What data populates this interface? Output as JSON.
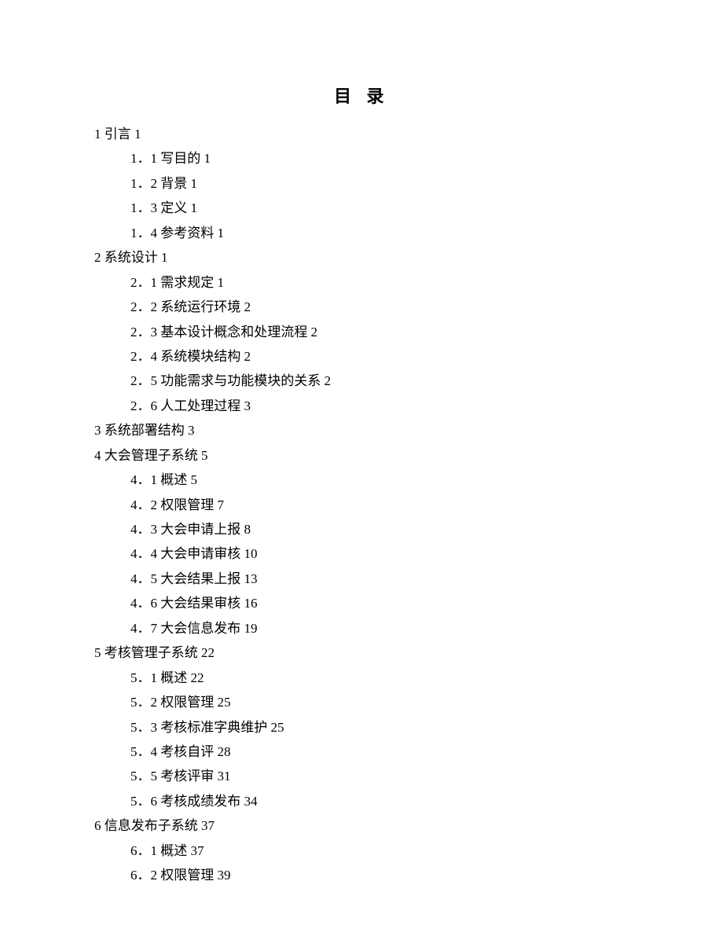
{
  "title": "目 录",
  "toc": [
    {
      "level": 1,
      "num": "1",
      "title": "引言",
      "page": "1"
    },
    {
      "level": 2,
      "num": "1．1",
      "title": "写目的",
      "page": "1"
    },
    {
      "level": 2,
      "num": "1．2",
      "title": "背景",
      "page": "1"
    },
    {
      "level": 2,
      "num": "1．3",
      "title": "定义",
      "page": "1"
    },
    {
      "level": 2,
      "num": "1．4",
      "title": "参考资料",
      "page": "1"
    },
    {
      "level": 1,
      "num": "2",
      "title": "系统设计",
      "page": "1"
    },
    {
      "level": 2,
      "num": "2．1",
      "title": "需求规定",
      "page": "1"
    },
    {
      "level": 2,
      "num": "2．2",
      "title": "系统运行环境",
      "page": "2"
    },
    {
      "level": 2,
      "num": "2．3",
      "title": "基本设计概念和处理流程",
      "page": "2"
    },
    {
      "level": 2,
      "num": "2．4",
      "title": "系统模块结构",
      "page": "2"
    },
    {
      "level": 2,
      "num": "2．5",
      "title": "功能需求与功能模块的关系",
      "page": "2"
    },
    {
      "level": 2,
      "num": "2．6",
      "title": "人工处理过程",
      "page": "3"
    },
    {
      "level": 1,
      "num": "3",
      "title": "系统部署结构",
      "page": "3"
    },
    {
      "level": 1,
      "num": "4",
      "title": "大会管理子系统",
      "page": "5"
    },
    {
      "level": 2,
      "num": "4．1",
      "title": "概述",
      "page": "5"
    },
    {
      "level": 2,
      "num": "4．2",
      "title": "权限管理",
      "page": "7"
    },
    {
      "level": 2,
      "num": "4．3",
      "title": "大会申请上报",
      "page": "8"
    },
    {
      "level": 2,
      "num": "4．4",
      "title": "大会申请审核",
      "page": "10"
    },
    {
      "level": 2,
      "num": "4．5",
      "title": "大会结果上报",
      "page": "13"
    },
    {
      "level": 2,
      "num": "4．6",
      "title": "大会结果审核",
      "page": "16"
    },
    {
      "level": 2,
      "num": "4．7",
      "title": "大会信息发布",
      "page": "19"
    },
    {
      "level": 1,
      "num": "5",
      "title": "考核管理子系统",
      "page": "22"
    },
    {
      "level": 2,
      "num": "5．1",
      "title": "概述",
      "page": "22"
    },
    {
      "level": 2,
      "num": "5．2",
      "title": "权限管理",
      "page": "25"
    },
    {
      "level": 2,
      "num": "5．3",
      "title": "考核标准字典维护",
      "page": "25"
    },
    {
      "level": 2,
      "num": "5．4",
      "title": "考核自评",
      "page": "28"
    },
    {
      "level": 2,
      "num": "5．5",
      "title": "考核评审",
      "page": "31"
    },
    {
      "level": 2,
      "num": "5．6",
      "title": "考核成绩发布",
      "page": "34"
    },
    {
      "level": 1,
      "num": "6",
      "title": "信息发布子系统",
      "page": "37"
    },
    {
      "level": 2,
      "num": "6．1",
      "title": "概述",
      "page": "37"
    },
    {
      "level": 2,
      "num": "6．2",
      "title": "权限管理",
      "page": "39"
    }
  ]
}
